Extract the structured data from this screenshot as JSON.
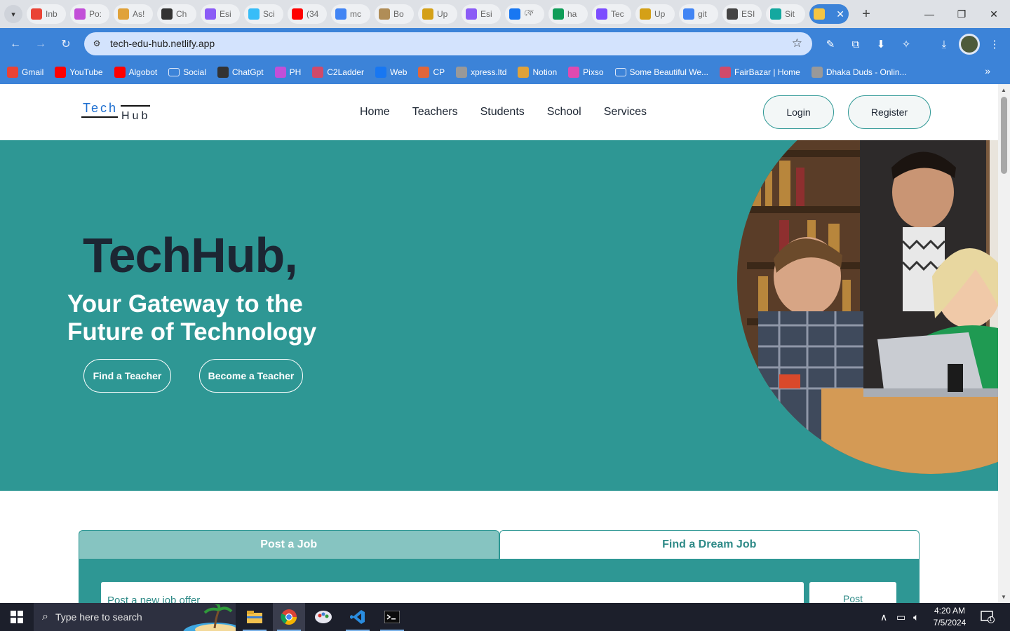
{
  "browser": {
    "tabs": [
      {
        "label": "Inb",
        "icon": "gmail-icon",
        "color": "#ea4335"
      },
      {
        "label": "Po:",
        "icon": "posthog-icon",
        "color": "#c24fd8"
      },
      {
        "label": "As!",
        "icon": "star-icon",
        "color": "#e0a23a"
      },
      {
        "label": "Ch",
        "icon": "chatgpt-icon",
        "color": "#333333"
      },
      {
        "label": "Esi",
        "icon": "vite-icon",
        "color": "#8b5cf6"
      },
      {
        "label": "Sci",
        "icon": "tailwind-icon",
        "color": "#38bdf8"
      },
      {
        "label": "(34",
        "icon": "youtube-icon",
        "color": "#ff0000"
      },
      {
        "label": "mc",
        "icon": "google-icon",
        "color": "#4285f4"
      },
      {
        "label": "Bo",
        "icon": "boat-icon",
        "color": "#b08d57"
      },
      {
        "label": "Up",
        "icon": "upwork-icon",
        "color": "#d4a017"
      },
      {
        "label": "Esi",
        "icon": "vite-icon",
        "color": "#8b5cf6"
      },
      {
        "label": "ফে",
        "icon": "facebook-icon",
        "color": "#1877f2"
      },
      {
        "label": "ha",
        "icon": "drive-icon",
        "color": "#0f9d58"
      },
      {
        "label": "Tec",
        "icon": "pen-icon",
        "color": "#7c4dff"
      },
      {
        "label": "Up",
        "icon": "upwork-icon",
        "color": "#d4a017"
      },
      {
        "label": "git",
        "icon": "google-icon",
        "color": "#4285f4"
      },
      {
        "label": "ESI",
        "icon": "github-icon",
        "color": "#444444"
      },
      {
        "label": "Sit",
        "icon": "diamond-icon",
        "color": "#14a89f"
      }
    ],
    "active_tab_icon": "vite-icon",
    "address_url": "tech-edu-hub.netlify.app",
    "bookmarks": [
      {
        "label": "Gmail",
        "icon": "gmail-icon",
        "color": "#ea4335"
      },
      {
        "label": "YouTube",
        "icon": "youtube-icon",
        "color": "#ff0000"
      },
      {
        "label": "Algobot",
        "icon": "youtube-icon",
        "color": "#ff0000"
      },
      {
        "label": "Social",
        "icon": "folder-icon",
        "color": "#3c83d8"
      },
      {
        "label": "ChatGpt",
        "icon": "chatgpt-icon",
        "color": "#333333"
      },
      {
        "label": "PH",
        "icon": "posthog-icon",
        "color": "#c24fd8"
      },
      {
        "label": "C2Ladder",
        "icon": "chart-icon",
        "color": "#d04a6a"
      },
      {
        "label": "Web",
        "icon": "facebook-icon",
        "color": "#1877f2"
      },
      {
        "label": "CP",
        "icon": "cp-icon",
        "color": "#e0663a"
      },
      {
        "label": "xpress.ltd",
        "icon": "image-icon",
        "color": "#999999"
      },
      {
        "label": "Notion",
        "icon": "person-icon",
        "color": "#e0a23a"
      },
      {
        "label": "Pixso",
        "icon": "pixso-icon",
        "color": "#e04ab0"
      },
      {
        "label": "Some Beautiful We...",
        "icon": "folder-icon",
        "color": "#3c83d8"
      },
      {
        "label": "FairBazar | Home",
        "icon": "bag-icon",
        "color": "#d04a6a"
      },
      {
        "label": "Dhaka Duds - Onlin...",
        "icon": "image-icon",
        "color": "#999999"
      }
    ]
  },
  "site": {
    "logo_top": "Tech",
    "logo_bottom": "Hub",
    "nav": [
      "Home",
      "Teachers",
      "Students",
      "School",
      "Services"
    ],
    "login_label": "Login",
    "register_label": "Register",
    "hero_title": "TechHub,",
    "hero_subtitle": "Your Gateway to the Future of Technology",
    "find_teacher_label": "Find a Teacher",
    "become_teacher_label": "Become a Teacher",
    "jobs": {
      "tab_post": "Post a Job",
      "tab_find": "Find a Dream Job",
      "input_placeholder": "Post a new job offer",
      "post_button": "Post"
    }
  },
  "taskbar": {
    "search_placeholder": "Type here to search",
    "time": "4:20 AM",
    "date": "7/5/2024",
    "notification_count": "1"
  },
  "colors": {
    "chrome_accent": "#3c83d8",
    "teal": "#2e9794",
    "teal_light": "#86c4c1",
    "dark_text": "#1c2633"
  }
}
